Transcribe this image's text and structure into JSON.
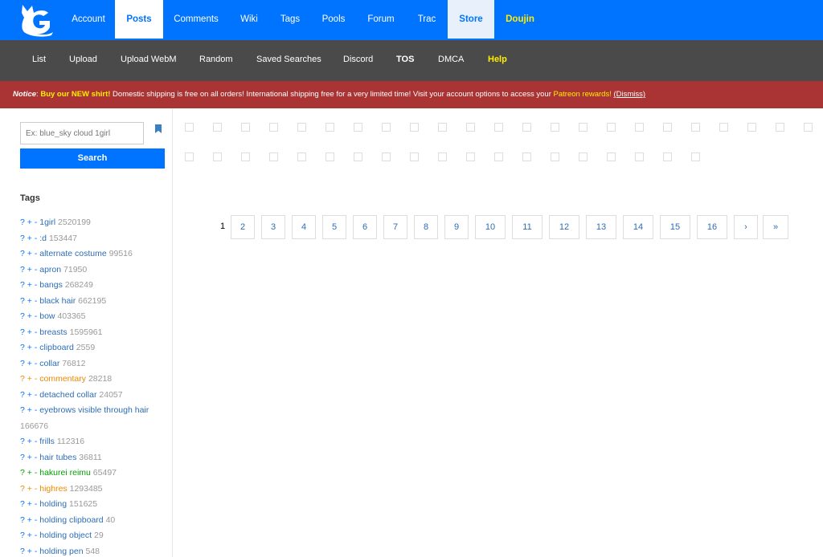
{
  "topnav": {
    "items": [
      "Account",
      "Posts",
      "Comments",
      "Wiki",
      "Tags",
      "Pools",
      "Forum",
      "Trac",
      "Store",
      "Doujin"
    ],
    "active": "Posts"
  },
  "subnav": {
    "items": [
      "List",
      "Upload",
      "Upload WebM",
      "Random",
      "Saved Searches",
      "Discord",
      "TOS",
      "DMCA",
      "Help"
    ]
  },
  "notice": {
    "label": "Notice",
    "highlight": "Buy our NEW shirt!",
    "body": " Domestic shipping is free on all orders! International shipping free for a very limited time! Visit your account options to access your ",
    "patreon": "Patreon rewards!",
    "dismiss": "(Dismiss)"
  },
  "search": {
    "placeholder": "Ex: blue_sky cloud 1girl",
    "button": "Search"
  },
  "tags": {
    "heading": "Tags",
    "items": [
      {
        "name": "1girl",
        "count": "2520199",
        "type": "general"
      },
      {
        "name": ":d",
        "count": "153447",
        "type": "general"
      },
      {
        "name": "alternate costume",
        "count": "99516",
        "type": "general"
      },
      {
        "name": "apron",
        "count": "71950",
        "type": "general"
      },
      {
        "name": "bangs",
        "count": "268249",
        "type": "general"
      },
      {
        "name": "black hair",
        "count": "662195",
        "type": "general"
      },
      {
        "name": "bow",
        "count": "403365",
        "type": "general"
      },
      {
        "name": "breasts",
        "count": "1595961",
        "type": "general"
      },
      {
        "name": "clipboard",
        "count": "2559",
        "type": "general"
      },
      {
        "name": "collar",
        "count": "76812",
        "type": "general"
      },
      {
        "name": "commentary",
        "count": "28218",
        "type": "meta"
      },
      {
        "name": "detached collar",
        "count": "24057",
        "type": "general"
      },
      {
        "name": "eyebrows visible through hair",
        "count": "166676",
        "type": "general"
      },
      {
        "name": "frills",
        "count": "112316",
        "type": "general"
      },
      {
        "name": "hair tubes",
        "count": "36811",
        "type": "general"
      },
      {
        "name": "hakurei reimu",
        "count": "65497",
        "type": "character"
      },
      {
        "name": "highres",
        "count": "1293485",
        "type": "meta"
      },
      {
        "name": "holding",
        "count": "151625",
        "type": "general"
      },
      {
        "name": "holding clipboard",
        "count": "40",
        "type": "general"
      },
      {
        "name": "holding object",
        "count": "29",
        "type": "general"
      },
      {
        "name": "holding pen",
        "count": "548",
        "type": "general"
      }
    ]
  },
  "pagination": {
    "current": "1",
    "pages": [
      "2",
      "3",
      "4",
      "5",
      "6",
      "7",
      "8",
      "9",
      "10",
      "11",
      "12",
      "13",
      "14",
      "15",
      "16"
    ],
    "next": "›",
    "last": "»"
  }
}
